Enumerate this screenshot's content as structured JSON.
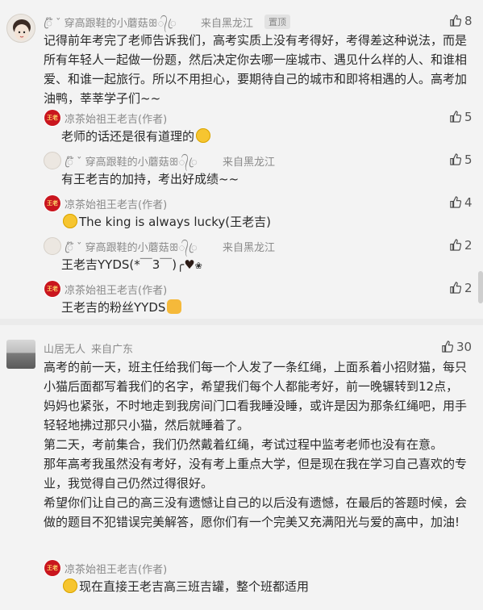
{
  "comment1": {
    "username": "ꦿ໊ ˇ 穿高跟鞋的小蘑菇ꕥ᭄ꦿ",
    "location": "来自黑龙江",
    "badge": "置顶",
    "likes": "8",
    "text": "记得前年考完了老师告诉我们，高考实质上没有考得好，考得差这种说法，而是所有年轻人一起做一份题，然后决定你去哪一座城市、遇见什么样的人、和谁相爱、和谁一起旅行。所以不用担心，要期待自己的城市和即将相遇的人。高考加油鸭，莘莘学子们~~",
    "replies": [
      {
        "username": "凉茶始祖王老吉(作者)",
        "location": "",
        "likes": "5",
        "text": "老师的话还是很有道理的",
        "emoji": "smile"
      },
      {
        "username": "ꦿ໊ ˇ 穿高跟鞋的小蘑菇ꕥ᭄ꦿ",
        "location": "来自黑龙江",
        "likes": "5",
        "text": "有王老吉的加持，考出好成绩~~",
        "emoji": ""
      },
      {
        "username": "凉茶始祖王老吉(作者)",
        "location": "",
        "likes": "4",
        "text": "The king is always lucky(王老吉)",
        "emoji": "grin"
      },
      {
        "username": "ꦿ໊ ˇ 穿高跟鞋的小蘑菇ꕥ᭄ꦿ",
        "location": "来自黑龙江",
        "likes": "2",
        "text": "王老吉YYDS(*￣3￣)╭",
        "emoji": "heart"
      },
      {
        "username": "凉茶始祖王老吉(作者)",
        "location": "",
        "likes": "2",
        "text": "王老吉的粉丝YYDS",
        "emoji": "hand"
      }
    ]
  },
  "comment2": {
    "username": "山居无人",
    "location": "来自广东",
    "likes": "30",
    "paragraphs": [
      "高考的前一天，班主任给我们每一个人发了一条红绳，上面系着小招财猫，每只小猫后面都写着我们的名字，希望我们每个人都能考好，前一晚辗转到12点，妈妈也紧张，不时地走到我房间门口看我睡没睡，或许是因为那条红绳吧，用手轻轻地拂过那只小猫，然后就睡着了。",
      "第二天，考前集合，我们仍然戴着红绳，考试过程中监考老师也没有在意。",
      "那年高考我虽然没有考好，没有考上重点大学，但是现在我在学习自己喜欢的专业，我觉得自己仍然过得很好。",
      "希望你们让自己的高三没有遗憾让自己的以后没有遗憾，在最后的答题时候，会做的题目不犯错误完美解答，愿你们有一个完美又充满阳光与爱的高中，加油!"
    ],
    "reply": {
      "username": "凉茶始祖王老吉(作者)",
      "text": "现在直接王老吉高三班吉罐，整个班都适用",
      "emoji": "grin"
    }
  },
  "avatar_brand_text": "王老吉",
  "colors": {
    "background": "#f3f3f3",
    "name": "#8a8a8a",
    "text": "#2a2a2a",
    "brand_red": "#c9151e"
  }
}
